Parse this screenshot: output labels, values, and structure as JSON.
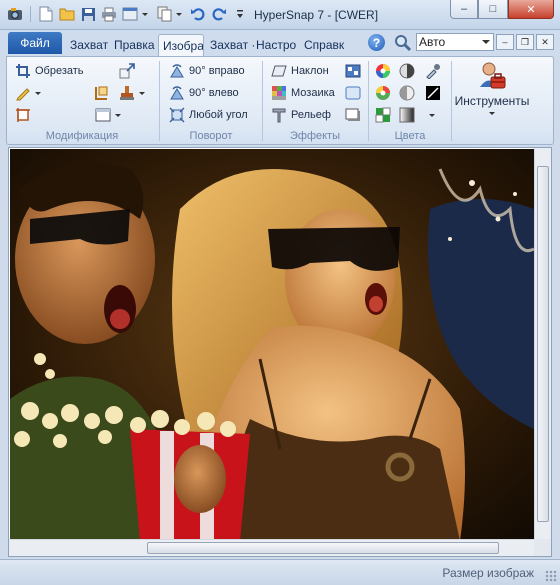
{
  "window": {
    "title": "HyperSnap 7 - [CWER]",
    "controls": {
      "minimize": "–",
      "maximize": "□",
      "close": "✕"
    }
  },
  "quick_access": {
    "icons": [
      "app-icon",
      "new-icon",
      "open-icon",
      "save-icon",
      "print-icon",
      "capture-icon",
      "copy-icon",
      "undo-icon",
      "redo-icon",
      "customize-icon"
    ]
  },
  "tabs": {
    "file": "Файл",
    "items": [
      "Захват",
      "Правка",
      "Изобра",
      "Захват ·",
      "Настро",
      "Справк"
    ],
    "active_index": 2
  },
  "help": {
    "label": "?"
  },
  "zoom_combo": {
    "value": "Авто"
  },
  "mdi_controls": {
    "minimize": "–",
    "restore": "❐",
    "close": "✕"
  },
  "ribbon": {
    "modification": {
      "label": "Модификация",
      "crop": "Обрезать"
    },
    "rotate": {
      "label": "Поворот",
      "right90": "90° вправо",
      "left90": "90° влево",
      "any_angle": "Любой угол"
    },
    "effects": {
      "label": "Эффекты",
      "skew": "Наклон",
      "mosaic": "Мозаика",
      "relief": "Рельеф"
    },
    "colors": {
      "label": "Цвета"
    },
    "tools": {
      "label": "Инструменты"
    }
  },
  "status": {
    "text": "Размер изображ"
  },
  "colors": {
    "file_button": "#2a66b5",
    "ribbon_bg": "#dce7f4",
    "title_bg": "#c4d5ea",
    "close_button": "#c7402c"
  }
}
